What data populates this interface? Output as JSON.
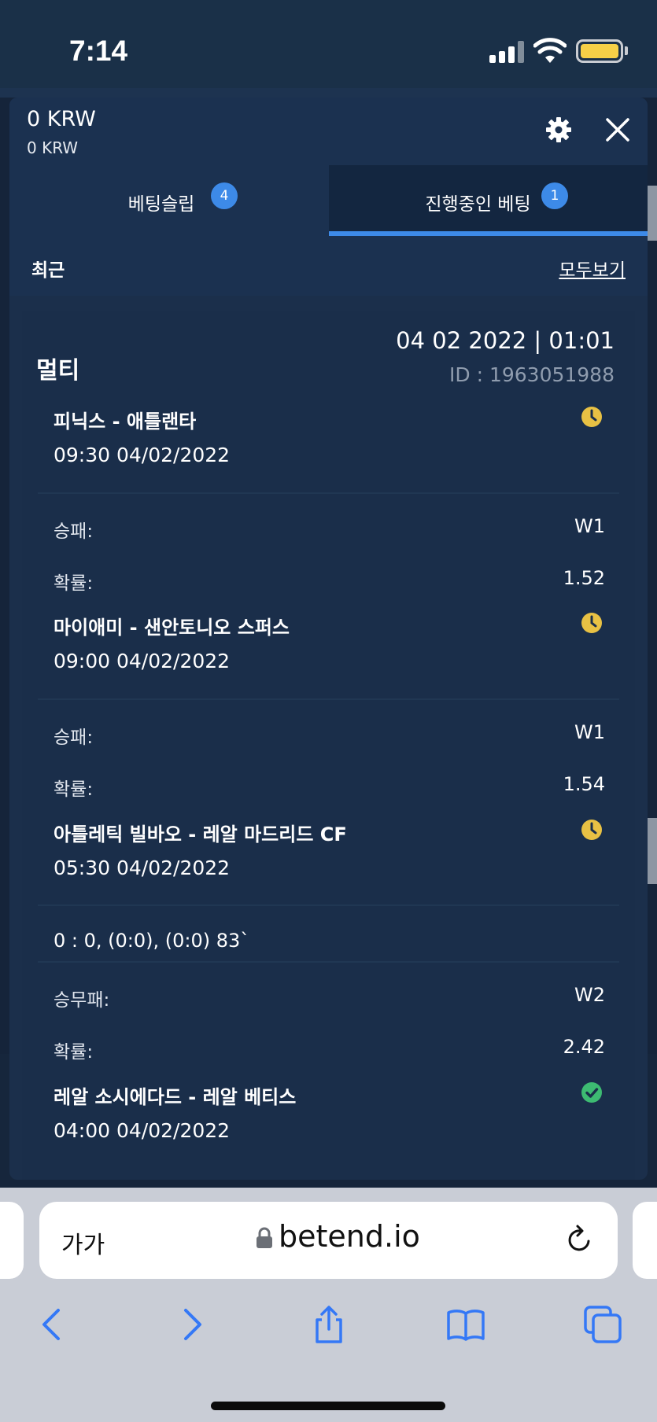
{
  "status_bar": {
    "time": "7:14"
  },
  "header": {
    "balance": "0 KRW",
    "balance_sub": "0 KRW"
  },
  "tabs": [
    {
      "label": "베팅슬립",
      "badge": "4"
    },
    {
      "label": "진행중인 베팅",
      "badge": "1"
    }
  ],
  "recent": {
    "label": "최근",
    "see_all": "모두보기"
  },
  "bet": {
    "type": "멀티",
    "date": "04 02 2022 | 01:01",
    "id": "ID :  1963051988",
    "matches": [
      {
        "title": "피닉스 - 애틀랜타",
        "time": "09:30   04/02/2022",
        "status_icon": "clock-icon",
        "market_label": "승패:",
        "market_value": "W1",
        "odds_label": "확률:",
        "odds_value": "1.52"
      },
      {
        "title": "마이애미 - 샌안토니오 스퍼스",
        "time": "09:00   04/02/2022",
        "status_icon": "clock-icon",
        "market_label": "승패:",
        "market_value": "W1",
        "odds_label": "확률:",
        "odds_value": "1.54"
      },
      {
        "title": "아틀레틱 빌바오 - 레알 마드리드 CF",
        "time": "05:30   04/02/2022",
        "status_icon": "clock-icon",
        "score": "0 : 0, (0:0), (0:0) 83`",
        "market_label": "승무패:",
        "market_value": "W2",
        "odds_label": "확률:",
        "odds_value": "2.42"
      },
      {
        "title": "레알 소시에다드 - 레알 베티스",
        "time": "04:00   04/02/2022",
        "status_icon": "check-icon"
      }
    ]
  },
  "browser": {
    "text_size": "가가",
    "url": "betend.io"
  },
  "colors": {
    "accent": "#3d8ae8",
    "pending": "#e8c144",
    "won": "#3dbb72",
    "panel": "#1b2f4b"
  }
}
